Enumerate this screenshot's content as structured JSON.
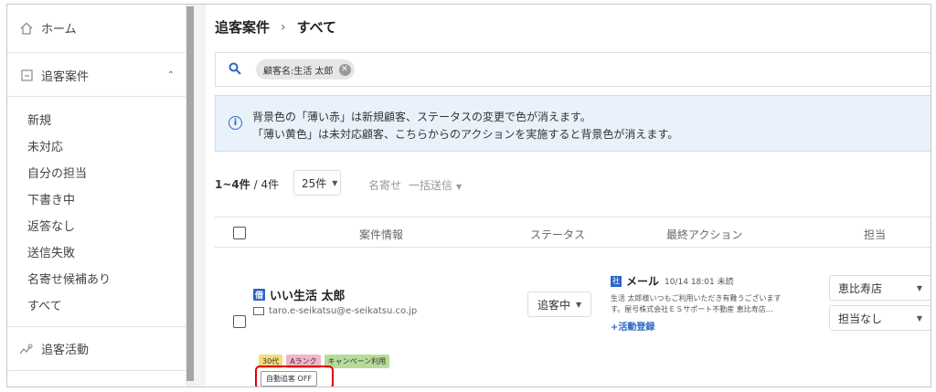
{
  "sidebar": {
    "home": "ホーム",
    "leads": "追客案件",
    "sub_items": [
      "新規",
      "未対応",
      "自分の担当",
      "下書き中",
      "返答なし",
      "送信失敗",
      "名寄せ候補あり",
      "すべて"
    ],
    "activities": "追客活動"
  },
  "breadcrumb": {
    "parent": "追客案件",
    "separator": "›",
    "current": "すべて"
  },
  "search": {
    "chip": "顧客名:生活 太郎"
  },
  "notice": {
    "line1": "背景色の「薄い赤」は新規顧客、ステータスの変更で色が消えます。",
    "line2": "「薄い黄色」は未対応顧客、こちらからのアクションを実施すると背景色が消えます。"
  },
  "list": {
    "range": "1~4件",
    "total": "/ 4件",
    "per_page": "25件",
    "action_merge": "名寄せ",
    "action_bulk": "一括送信"
  },
  "columns": {
    "info": "案件情報",
    "status": "ステータス",
    "last_action": "最終アクション",
    "owner": "担当"
  },
  "row": {
    "prefix_badge": "借",
    "name": "いい生活 太郎",
    "email": "taro.e-seikatsu@e-seikatsu.co.jp",
    "tags": [
      {
        "label": "30代",
        "color": "#f6dc7a"
      },
      {
        "label": "Aランク",
        "color": "#f4b3c6"
      },
      {
        "label": "キャンペーン利用",
        "color": "#b7dc9a"
      }
    ],
    "auto_follow": "自動追客 OFF",
    "status": "追客中",
    "last_action": {
      "badge": "社",
      "type": "メール",
      "date": "10/14 18:01 未読",
      "body1": "生活 太郎様いつもご利用いただき有難うございます",
      "body2": "す。屋号株式会社ＥＳサポート不動産 恵比寿店…",
      "register": "+活動登録"
    },
    "store": "恵比寿店",
    "owner": "担当なし"
  },
  "colors": {
    "accent": "#2c65c6",
    "highlight": "#e00000",
    "notice_bg": "#e9f2fb"
  }
}
